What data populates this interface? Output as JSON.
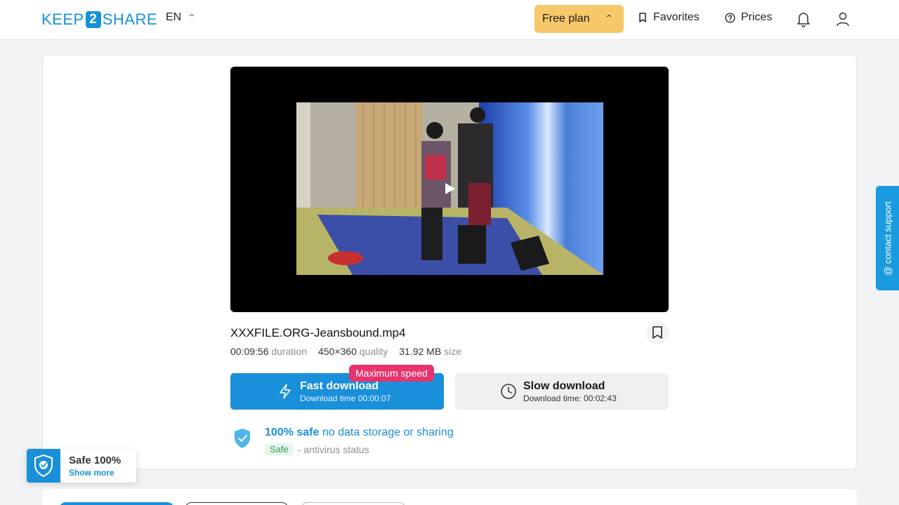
{
  "header": {
    "logo": {
      "left": "KEEP",
      "mid": "2",
      "right": "SHARE"
    },
    "language": "EN",
    "plan": "Free plan",
    "favorites": "Favorites",
    "prices": "Prices",
    "icons": [
      "chevron-up-icon",
      "bookmark-icon",
      "help-circle-icon",
      "bell-icon",
      "user-icon"
    ]
  },
  "file": {
    "name": "XXXFILE.ORG-Jeansbound.mp4",
    "duration_value": "00:09:56",
    "duration_label": "duration",
    "quality_value": "450×360",
    "quality_label": "quality",
    "size_value": "31.92 MB",
    "size_label": "size"
  },
  "downloads": {
    "badge": "Maximum speed",
    "fast_title": "Fast download",
    "fast_sub": "Download time 00:00:07",
    "slow_title": "Slow download",
    "slow_sub": "Download time: 00:02:43"
  },
  "safety": {
    "strong": "100% safe",
    "rest": "no data storage or sharing",
    "pill": "Safe",
    "status": "- antivirus status"
  },
  "support": {
    "label": "@ contact support"
  },
  "widget": {
    "title": "Safe 100%",
    "link": "Show more"
  },
  "colors": {
    "accent": "#1a8fda",
    "plan": "#f7c86a",
    "badge": "#e7336e"
  }
}
